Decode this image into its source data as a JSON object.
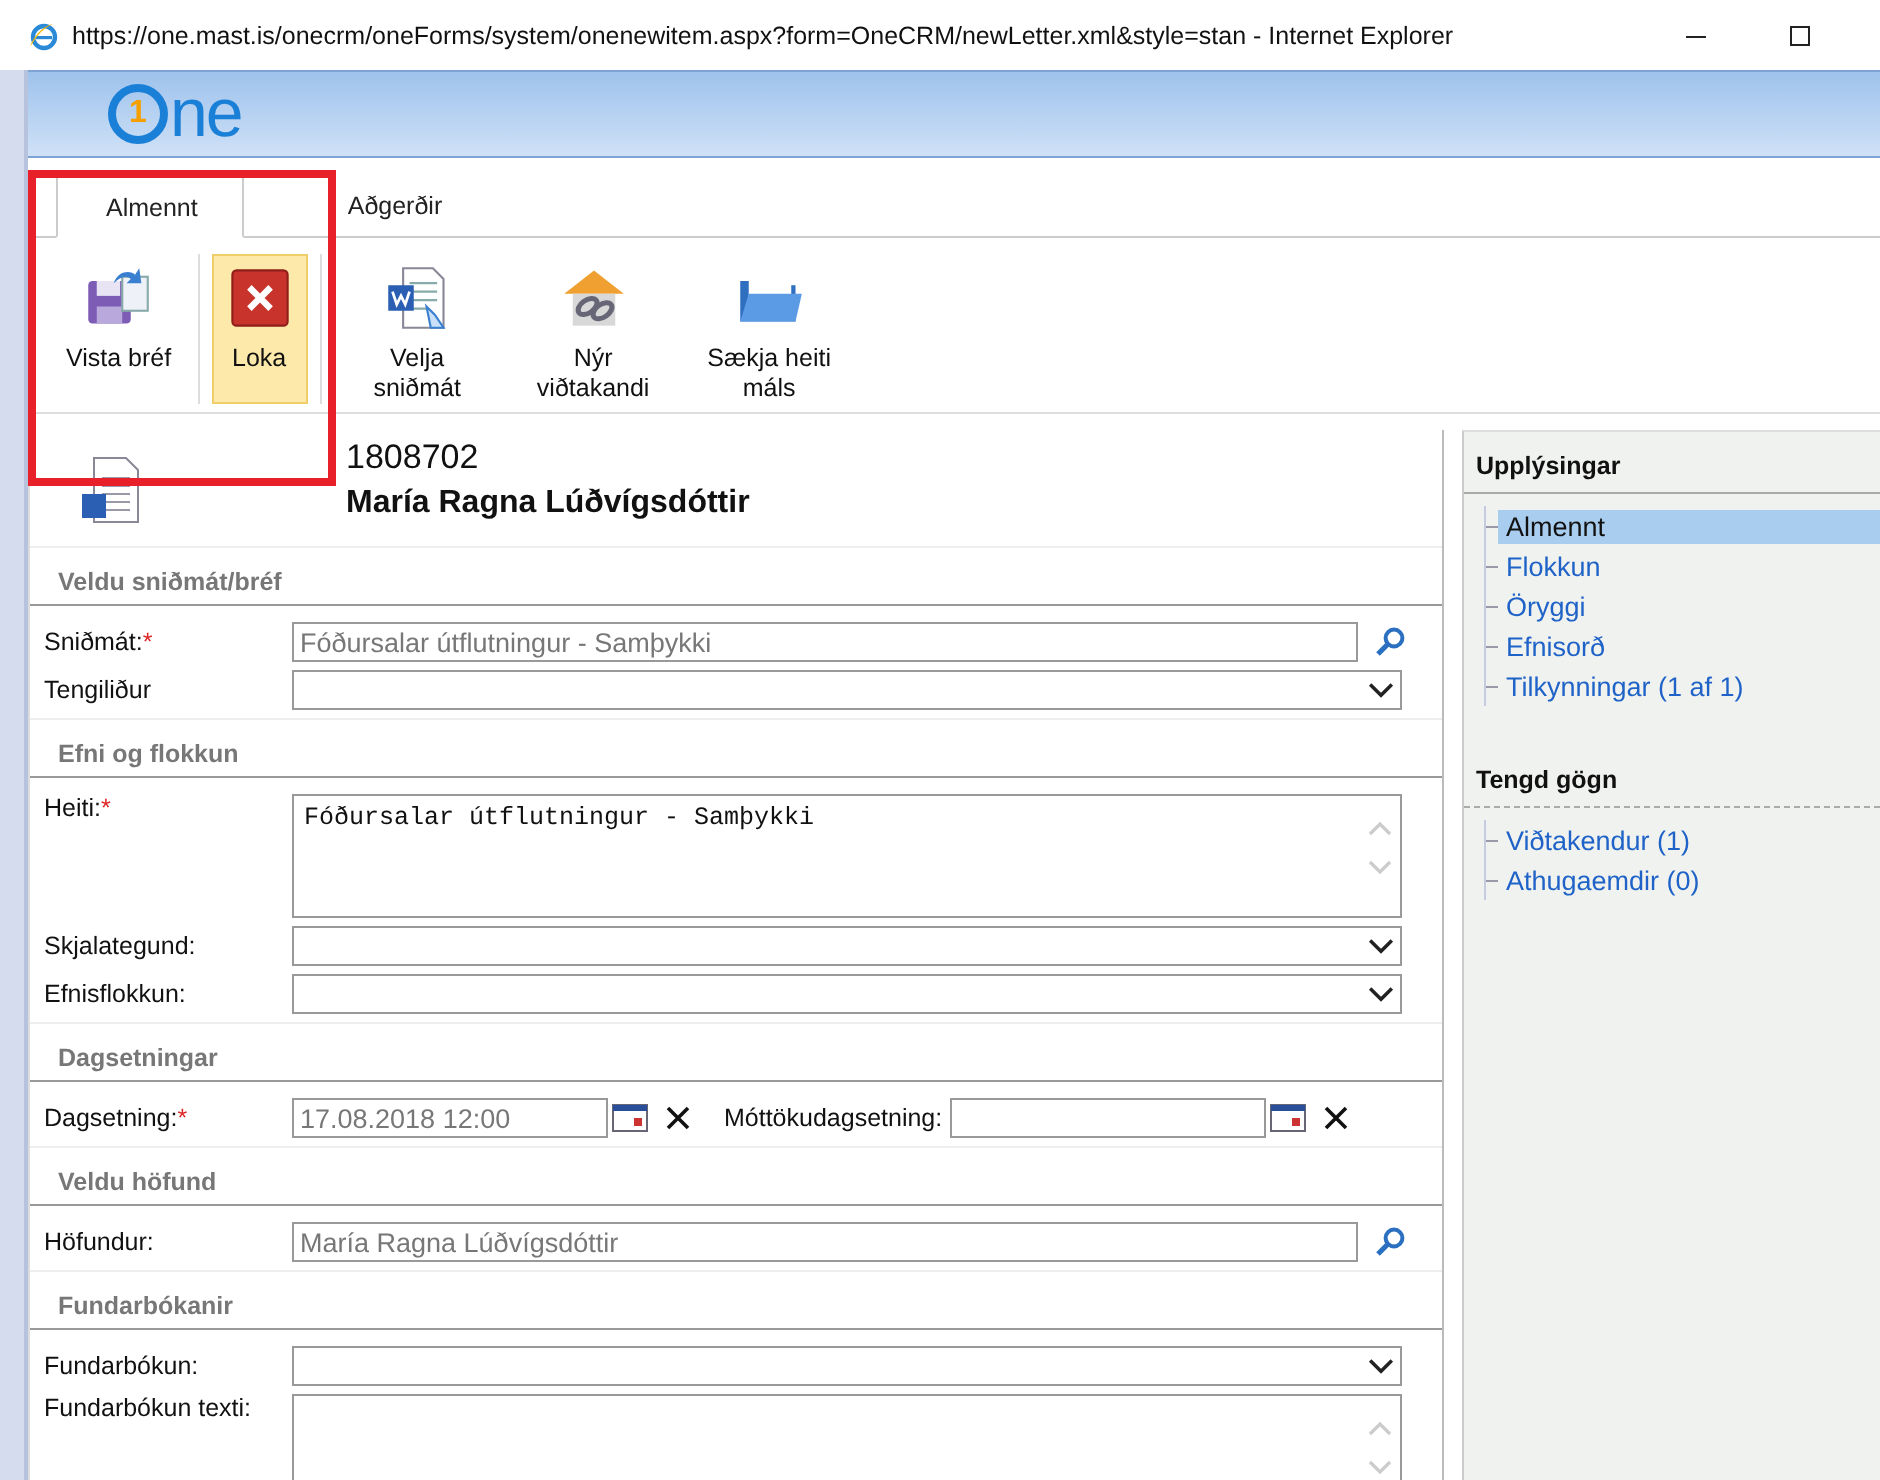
{
  "window": {
    "title": "https://one.mast.is/onecrm/oneForms/system/onenewitem.aspx?form=OneCRM/newLetter.xml&style=stan - Internet Explorer"
  },
  "logo": {
    "badge": "1",
    "text": "ne"
  },
  "tabs": [
    {
      "label": "Almennt",
      "selected": true
    },
    {
      "label": "Aðgerðir",
      "selected": false
    }
  ],
  "toolbar": [
    {
      "kind": "save",
      "label": "Vista bréf",
      "selected": false
    },
    {
      "kind": "close",
      "label": "Loka",
      "selected": true
    },
    {
      "kind": "word",
      "label": "Velja sniðmát",
      "selected": false
    },
    {
      "kind": "contact",
      "label": "Nýr viðtakandi",
      "selected": false
    },
    {
      "kind": "folder",
      "label": "Sækja heiti máls",
      "selected": false
    }
  ],
  "document": {
    "number": "1808702",
    "name": "María Ragna Lúðvígsdóttir"
  },
  "sections": [
    {
      "title": "Veldu sniðmát/bréf",
      "fields": [
        {
          "kind": "lookup",
          "label": "Sniðmát:",
          "mark": "*",
          "value": "Fóðursalar útflutningur - Samþykki"
        },
        {
          "kind": "select",
          "label": "Tengiliður"
        }
      ]
    },
    {
      "title": "Efni og flokkun",
      "fields": [
        {
          "kind": "textarea",
          "label": "Heiti:",
          "mark": "*",
          "value": "Fóðursalar útflutningur - Samþykki"
        },
        {
          "kind": "select",
          "label": "Skjalategund:"
        },
        {
          "kind": "select",
          "label": "Efnisflokkun:"
        }
      ]
    },
    {
      "title": "Dagsetningar",
      "fields": [
        {
          "kind": "date",
          "label": "Dagsetning:",
          "mark": "*",
          "value": "17.08.2018 12:00",
          "second_label": "Móttökudagsetning:"
        }
      ]
    },
    {
      "title": "Veldu höfund",
      "fields": [
        {
          "kind": "lookup",
          "label": "Höfundur:",
          "value": "María Ragna Lúðvígsdóttir"
        }
      ]
    },
    {
      "title": "Fundarbókanir",
      "fields": [
        {
          "kind": "select",
          "label": "Fundarbókun:"
        },
        {
          "kind": "textarea",
          "label": "Fundarbókun texti:"
        }
      ]
    }
  ],
  "side_panel": [
    {
      "title": "Upplýsingar",
      "items": [
        {
          "label": "Almennt",
          "selected": true
        },
        {
          "label": "Flokkun",
          "selected": false
        },
        {
          "label": "Öryggi",
          "selected": false
        },
        {
          "label": "Efnisorð",
          "selected": false
        },
        {
          "label": "Tilkynningar (1 af 1)",
          "selected": false
        }
      ]
    },
    {
      "title": "Tengd gögn",
      "items": [
        {
          "label": "Viðtakendur (1)",
          "selected": false
        },
        {
          "label": "Athugaemdir (0)",
          "selected": false
        }
      ]
    }
  ]
}
